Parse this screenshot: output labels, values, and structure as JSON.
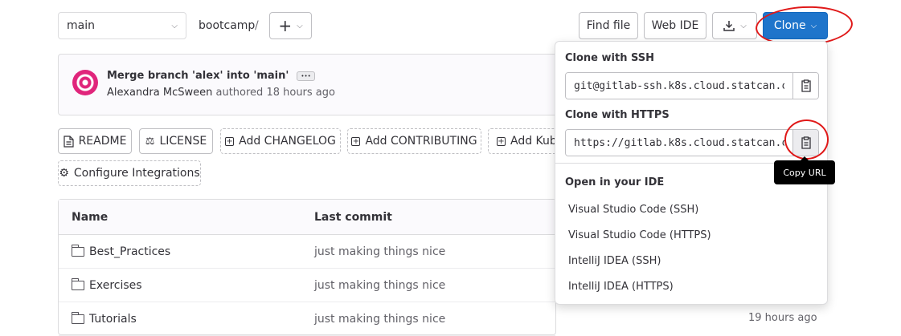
{
  "branch": {
    "selected": "main"
  },
  "breadcrumb": {
    "repo": "bootcamp",
    "separator": "/"
  },
  "toolbar": {
    "add_symbol": "+",
    "find_file": "Find file",
    "web_ide": "Web IDE",
    "clone": "Clone"
  },
  "commit": {
    "message": "Merge branch 'alex' into 'main'",
    "more": "•••",
    "author": "Alexandra McSween",
    "action": "authored",
    "time": "18 hours ago"
  },
  "quick_links": [
    {
      "label": "README",
      "icon": "file-icon"
    },
    {
      "label": "LICENSE",
      "icon": "scale-icon"
    },
    {
      "label": "Add CHANGELOG",
      "icon": "plus-square-icon"
    },
    {
      "label": "Add CONTRIBUTING",
      "icon": "plus-square-icon"
    },
    {
      "label": "Add Kub",
      "icon": "plus-square-icon"
    },
    {
      "label": "Configure Integrations",
      "icon": "gear-icon"
    }
  ],
  "table": {
    "headers": [
      "Name",
      "Last commit"
    ],
    "rows": [
      {
        "name": "Best_Practices",
        "commit": "just making things nice",
        "time": ""
      },
      {
        "name": "Exercises",
        "commit": "just making things nice",
        "time": ""
      },
      {
        "name": "Tutorials",
        "commit": "just making things nice",
        "time": "19 hours ago"
      }
    ]
  },
  "clone_dropdown": {
    "ssh_label": "Clone with SSH",
    "ssh_url": "git@gitlab-ssh.k8s.cloud.statcan.c",
    "https_label": "Clone with HTTPS",
    "https_url": "https://gitlab.k8s.cloud.statcan.c",
    "ide_label": "Open in your IDE",
    "ide_options": [
      "Visual Studio Code (SSH)",
      "Visual Studio Code (HTTPS)",
      "IntelliJ IDEA (SSH)",
      "IntelliJ IDEA (HTTPS)"
    ],
    "tooltip": "Copy URL"
  },
  "colors": {
    "primary": "#1f75cb",
    "annotation": "#e01919"
  }
}
